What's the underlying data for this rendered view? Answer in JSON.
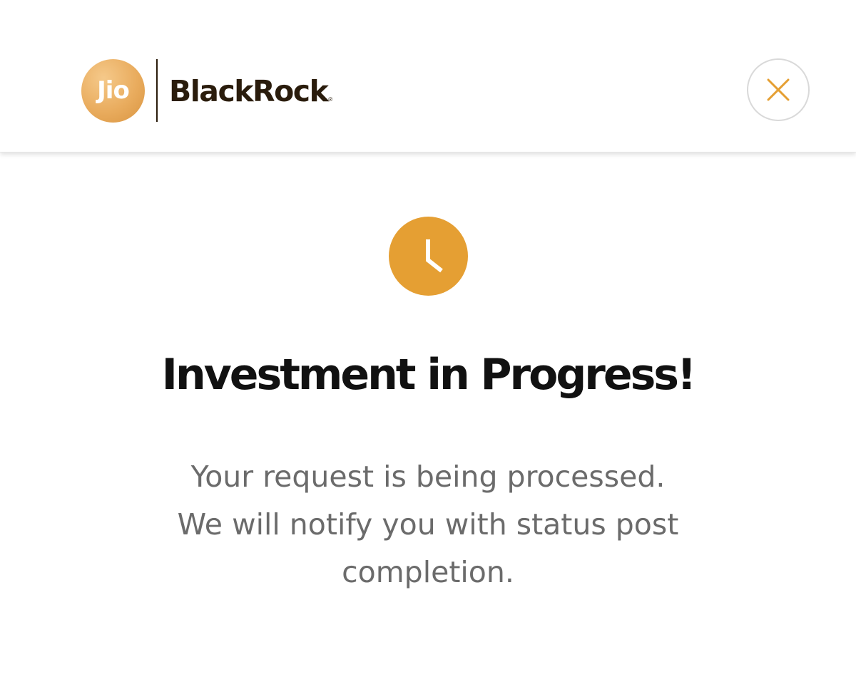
{
  "header": {
    "logo": {
      "jio_text": "Jio",
      "brand_text": "BlackRock",
      "registered_mark": "®",
      "jio_color": "#E9AC5E",
      "brand_color": "#2A1C0C"
    },
    "close_button": {
      "icon": "close-icon",
      "color": "#E59F33"
    }
  },
  "status": {
    "icon": "clock-icon",
    "icon_color": "#E59F33",
    "title": "Investment in Progress!",
    "message_lines": [
      "Your request is being processed.",
      "We will notify you with status post",
      "completion."
    ]
  }
}
